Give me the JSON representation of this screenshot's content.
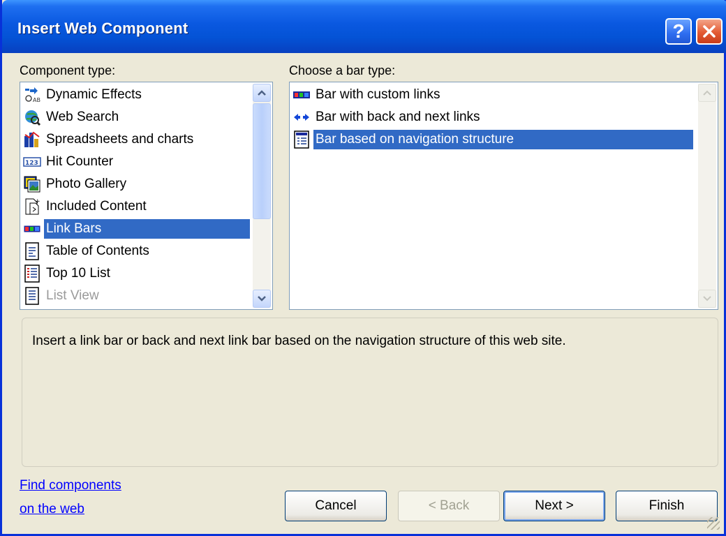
{
  "window": {
    "title": "Insert Web Component"
  },
  "titlebar": {
    "help_glyph": "?",
    "close_glyph": "✕"
  },
  "component_type": {
    "label": "Component type:",
    "items": [
      {
        "label": "Dynamic Effects",
        "icon": "dynamic-effects-icon",
        "state": "normal"
      },
      {
        "label": "Web Search",
        "icon": "web-search-icon",
        "state": "normal"
      },
      {
        "label": "Spreadsheets and charts",
        "icon": "spreadsheets-icon",
        "state": "normal"
      },
      {
        "label": "Hit Counter",
        "icon": "hit-counter-icon",
        "state": "normal"
      },
      {
        "label": "Photo Gallery",
        "icon": "photo-gallery-icon",
        "state": "normal"
      },
      {
        "label": "Included Content",
        "icon": "included-content-icon",
        "state": "normal"
      },
      {
        "label": "Link Bars",
        "icon": "link-bars-icon",
        "state": "selected"
      },
      {
        "label": "Table of Contents",
        "icon": "table-of-contents-icon",
        "state": "normal"
      },
      {
        "label": "Top 10 List",
        "icon": "top-10-list-icon",
        "state": "normal"
      },
      {
        "label": "List View",
        "icon": "list-view-icon",
        "state": "disabled"
      }
    ],
    "hit_counter_badge": "123"
  },
  "bar_type": {
    "label": "Choose a bar type:",
    "items": [
      {
        "label": "Bar with custom links",
        "icon": "custom-links-bar-icon",
        "state": "normal"
      },
      {
        "label": "Bar with back and next links",
        "icon": "back-next-arrows-icon",
        "state": "normal"
      },
      {
        "label": "Bar based on navigation structure",
        "icon": "navigation-structure-icon",
        "state": "selected"
      }
    ]
  },
  "description": "Insert a link bar or back and next link bar based on the navigation structure of this web site.",
  "links": {
    "line1": "Find components",
    "line2": "on the web"
  },
  "buttons": {
    "cancel": "Cancel",
    "back": "< Back",
    "next": "Next >",
    "finish": "Finish"
  },
  "colors": {
    "selection": "#316ac5",
    "titlebar": "#0453d6",
    "dialog_bg": "#ece9d8",
    "link": "#0000ff"
  }
}
